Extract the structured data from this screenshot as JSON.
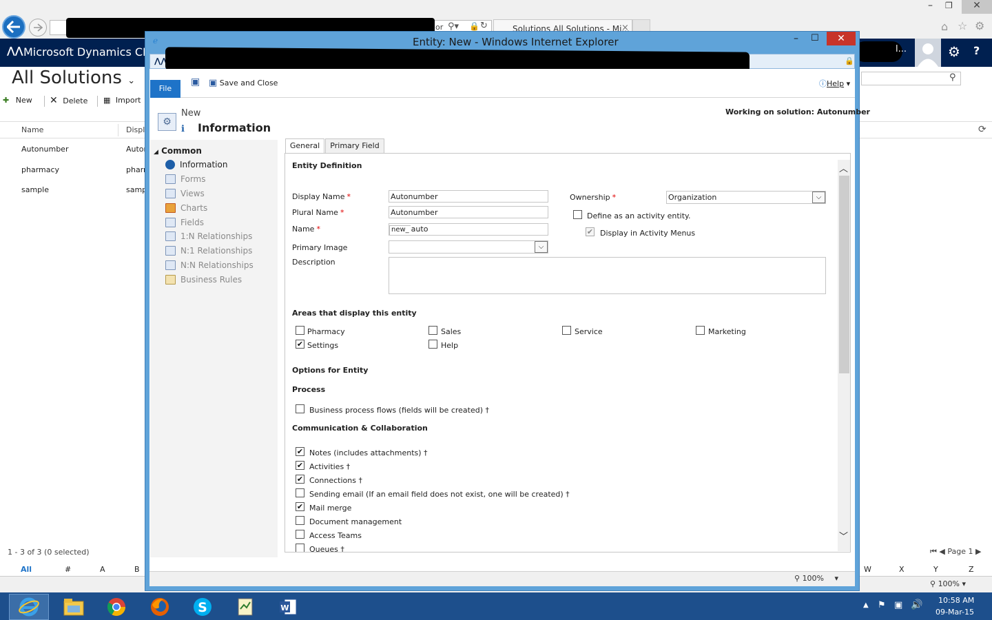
{
  "browser_bg": {
    "address_tail": "or",
    "tab_title": "Solutions All Solutions - Mi..."
  },
  "crm": {
    "brand": "Microsoft Dynamics CRI",
    "page_title": "All Solutions",
    "toolbar": {
      "new": "New",
      "delete": "Delete",
      "import": "Import"
    },
    "grid": {
      "columns": [
        "Name",
        "Displa"
      ],
      "rows": [
        {
          "name": "Autonumber",
          "display": "Autor"
        },
        {
          "name": "pharmacy",
          "display": "pharn"
        },
        {
          "name": "sample",
          "display": "samp"
        }
      ],
      "status": "1 - 3 of 3 (0 selected)",
      "page": "Page 1"
    },
    "alpha_left": [
      "All",
      "#",
      "A",
      "B"
    ],
    "alpha_right": [
      "W",
      "X",
      "Y",
      "Z"
    ],
    "zoom": "100%"
  },
  "popup": {
    "title": "Entity: New - Windows Internet Explorer",
    "ribbon": {
      "file": "File",
      "save_close": "Save and Close",
      "help": "Help"
    },
    "header": {
      "subtitle": "New",
      "title": "Information",
      "working_on": "Working on solution: Autonumber"
    },
    "nav": {
      "group": "Common",
      "items": [
        "Information",
        "Forms",
        "Views",
        "Charts",
        "Fields",
        "1:N Relationships",
        "N:1 Relationships",
        "N:N Relationships",
        "Business Rules"
      ]
    },
    "tabs": [
      "General",
      "Primary Field"
    ],
    "form": {
      "entity_definition": "Entity Definition",
      "display_name_label": "Display Name",
      "display_name_value": "Autonumber",
      "plural_name_label": "Plural Name",
      "plural_name_value": "Autonumber",
      "name_label": "Name",
      "name_prefix": "new_",
      "name_value": "auto",
      "primary_image_label": "Primary Image",
      "description_label": "Description",
      "ownership_label": "Ownership",
      "ownership_value": "Organization",
      "activity_entity_label": "Define as an activity entity.",
      "activity_menus_label": "Display in Activity Menus",
      "areas_heading": "Areas that display this entity",
      "areas": [
        {
          "label": "Pharmacy",
          "checked": false
        },
        {
          "label": "Sales",
          "checked": false
        },
        {
          "label": "Service",
          "checked": false
        },
        {
          "label": "Marketing",
          "checked": false
        },
        {
          "label": "Settings",
          "checked": true
        },
        {
          "label": "Help",
          "checked": false
        }
      ],
      "options_heading": "Options for Entity",
      "process_heading": "Process",
      "bpf_label": "Business process flows (fields will be created) †",
      "comm_heading": "Communication & Collaboration",
      "comm_items": [
        {
          "label": "Notes (includes attachments) †",
          "checked": true
        },
        {
          "label": "Activities †",
          "checked": true
        },
        {
          "label": "Connections †",
          "checked": true
        },
        {
          "label": "Sending email (If an email field does not exist, one will be created) †",
          "checked": false
        },
        {
          "label": "Mail merge",
          "checked": true
        },
        {
          "label": "Document management",
          "checked": false
        },
        {
          "label": "Access Teams",
          "checked": false
        },
        {
          "label": "Queues †",
          "checked": false
        }
      ]
    },
    "status_zoom": "100%"
  },
  "taskbar": {
    "time": "10:58 AM",
    "date": "09-Mar-15"
  },
  "colors": {
    "crm_navy": "#002050",
    "popup_frame": "#5fa3d9",
    "file_blue": "#1e73c8",
    "taskbar": "#1d4f8c"
  }
}
